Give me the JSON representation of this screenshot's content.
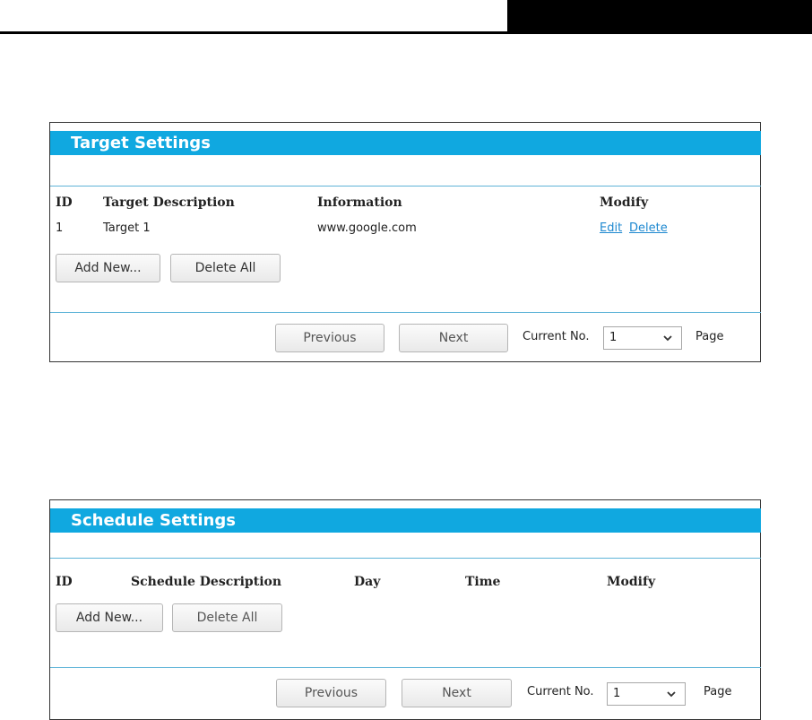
{
  "target_settings": {
    "title": "Target Settings",
    "columns": [
      "ID",
      "Target Description",
      "Information",
      "Modify"
    ],
    "rows": [
      {
        "id": "1",
        "description": "Target 1",
        "information": "www.google.com",
        "edit_label": "Edit",
        "delete_label": "Delete"
      }
    ],
    "add_new_label": "Add New...",
    "delete_all_label": "Delete All",
    "previous_label": "Previous",
    "next_label": "Next",
    "current_no_label": "Current No.",
    "current_no_value": "1",
    "page_label": "Page"
  },
  "schedule_settings": {
    "title": "Schedule Settings",
    "columns": [
      "ID",
      "Schedule Description",
      "Day",
      "Time",
      "Modify"
    ],
    "add_new_label": "Add New...",
    "delete_all_label": "Delete All",
    "previous_label": "Previous",
    "next_label": "Next",
    "current_no_label": "Current No.",
    "current_no_value": "1",
    "page_label": "Page"
  },
  "colors": {
    "title_bar": "#10a8e0",
    "separator": "#5fb4d8",
    "link": "#1e88d0"
  },
  "icons": {
    "dropdown": "chevron-down-icon"
  }
}
